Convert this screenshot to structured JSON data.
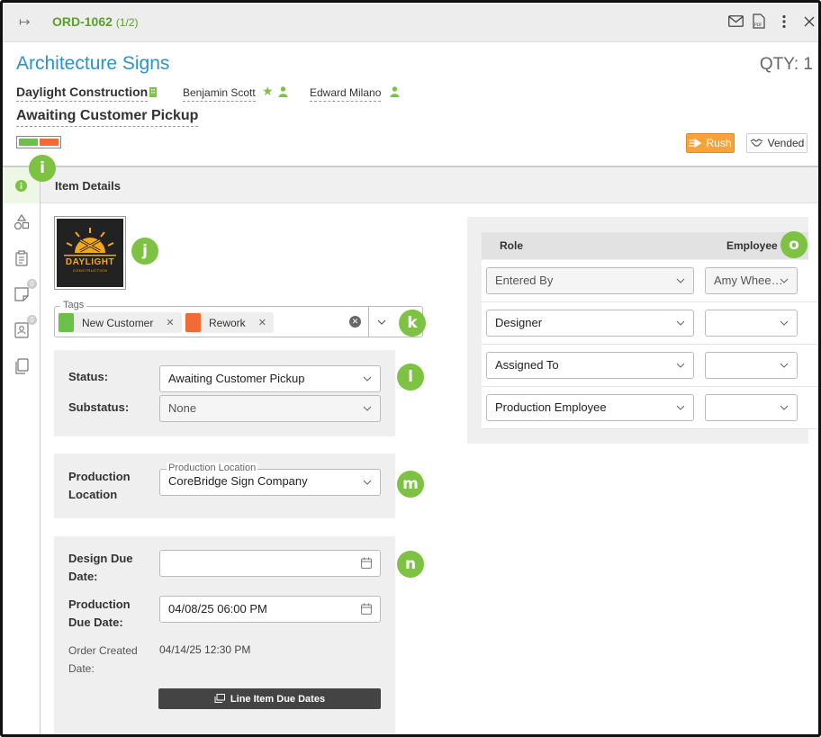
{
  "topbar": {
    "order_number": "ORD-1062",
    "order_count": "(1/2)",
    "icons": [
      "collapse-icon",
      "mail-icon",
      "pdf-icon",
      "more-icon",
      "close-icon"
    ]
  },
  "header": {
    "title": "Architecture Signs",
    "qty": "QTY: 1",
    "company": "Daylight Construction",
    "contact": "Benjamin Scott",
    "salesperson": "Edward Milano",
    "status": "Awaiting Customer Pickup",
    "status_colors": [
      "#6cc04a",
      "#f26a35"
    ],
    "rush_label": "Rush",
    "vended_label": "Vended"
  },
  "section": {
    "title": "Item Details"
  },
  "callouts": {
    "i": "i",
    "j": "j",
    "k": "k",
    "l": "l",
    "m": "m",
    "n": "n",
    "o": "o"
  },
  "sidenav": {
    "items": [
      "info-icon",
      "shapes-icon",
      "clipboard-icon",
      "notes-icon",
      "contacts-icon",
      "copy-icon"
    ],
    "badges": [
      "0",
      "0"
    ]
  },
  "logo": {
    "line1": "DAYLIGHT",
    "line2": "CONSTRUCTION"
  },
  "tags": {
    "legend": "Tags",
    "items": [
      {
        "label": "New Customer",
        "color": "#6cc04a"
      },
      {
        "label": "Rework",
        "color": "#f26a35"
      }
    ],
    "remove_glyph": "✕",
    "clear_glyph": "✕"
  },
  "status_panel": {
    "status_label": "Status:",
    "status_value": "Awaiting Customer Pickup",
    "substatus_label": "Substatus:",
    "substatus_value": "None"
  },
  "location_panel": {
    "label_line1": "Production",
    "label_line2": "Location",
    "float_label": "Production Location",
    "value": "CoreBridge Sign Company"
  },
  "dates_panel": {
    "design_label_1": "Design Due",
    "design_label_2": "Date:",
    "design_value": "",
    "production_label_1": "Production",
    "production_label_2": "Due Date:",
    "production_value": "04/08/25 06:00 PM",
    "created_label_1": "Order Created",
    "created_label_2": "Date:",
    "created_value": "04/14/25 12:30 PM",
    "button_label": "Line Item Due Dates"
  },
  "roles": {
    "head_role": "Role",
    "head_employee": "Employee",
    "rows": [
      {
        "role": "Entered By",
        "employee": "Amy Whee…",
        "disabled": true
      },
      {
        "role": "Designer",
        "employee": ""
      },
      {
        "role": "Assigned To",
        "employee": ""
      },
      {
        "role": "Production Employee",
        "employee": ""
      }
    ]
  }
}
